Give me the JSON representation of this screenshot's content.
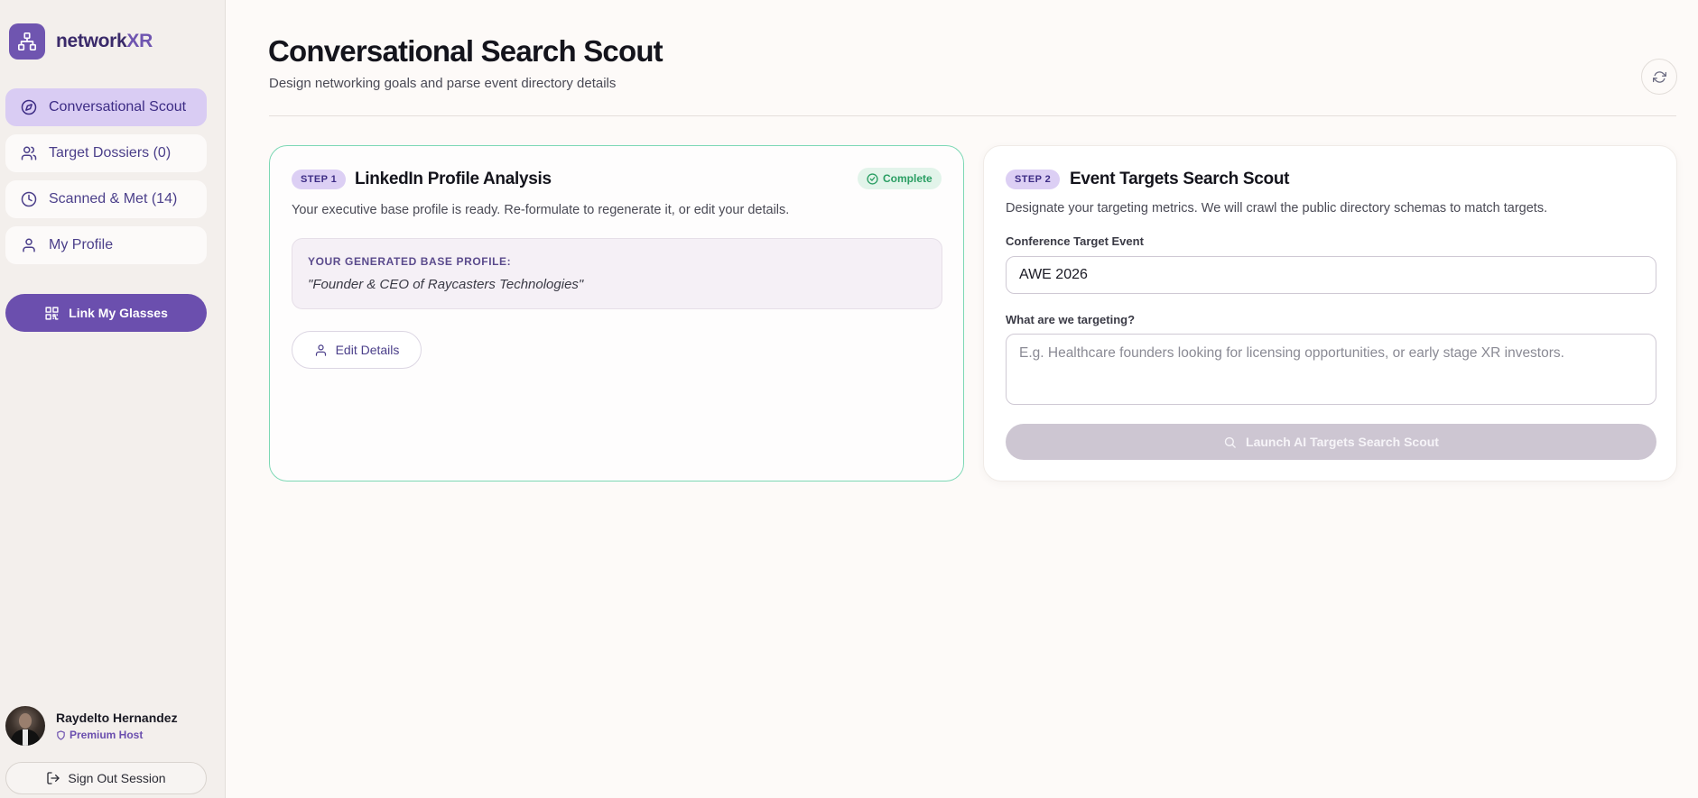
{
  "app": {
    "brand_prefix": "network",
    "brand_suffix": "XR"
  },
  "sidebar": {
    "items": [
      {
        "label": "Conversational Scout",
        "icon": "compass-icon",
        "active": true
      },
      {
        "label": "Target Dossiers (0)",
        "icon": "users-icon",
        "active": false
      },
      {
        "label": "Scanned & Met (14)",
        "icon": "clock-icon",
        "active": false
      },
      {
        "label": "My Profile",
        "icon": "user-icon",
        "active": false
      }
    ],
    "link_button": "Link My Glasses",
    "user": {
      "name": "Raydelto Hernandez",
      "role": "Premium Host"
    },
    "sign_out": "Sign Out Session"
  },
  "header": {
    "title": "Conversational Search Scout",
    "subtitle": "Design networking goals and parse event directory details"
  },
  "step1": {
    "pill": "STEP 1",
    "title": "LinkedIn Profile Analysis",
    "status": "Complete",
    "description": "Your executive base profile is ready. Re-formulate to regenerate it, or edit your details.",
    "profile_label": "YOUR GENERATED BASE PROFILE:",
    "profile_value": "\"Founder & CEO of Raycasters Technologies\"",
    "edit_button": "Edit Details"
  },
  "step2": {
    "pill": "STEP 2",
    "title": "Event Targets Search Scout",
    "description": "Designate your targeting metrics. We will crawl the public directory schemas to match targets.",
    "event_label": "Conference Target Event",
    "event_value": "AWE 2026",
    "target_label": "What are we targeting?",
    "target_placeholder": "E.g. Healthcare founders looking for licensing opportunities, or early stage XR investors.",
    "launch_button": "Launch AI Targets Search Scout"
  },
  "colors": {
    "accent": "#6b4fae",
    "active_nav": "#d9ccf3",
    "complete_green": "#2a9e63",
    "card_border_complete": "#7dd8b5"
  }
}
